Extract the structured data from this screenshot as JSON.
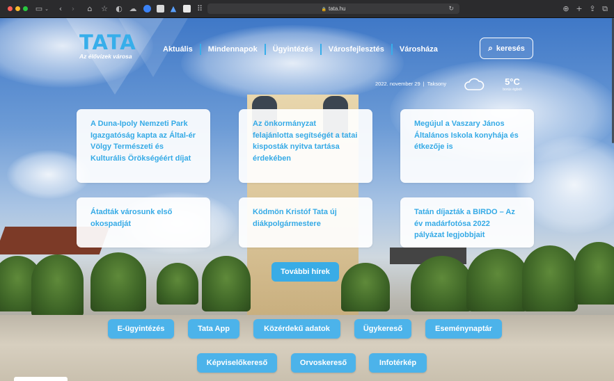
{
  "browser": {
    "url": "tata.hu",
    "icons": [
      "sidebar-icon",
      "back-icon",
      "forward-icon",
      "home-icon",
      "bookmark-star-icon",
      "shield-icon",
      "cloud-icon",
      "download-icon",
      "share-icon",
      "new-tab-icon",
      "tabs-overview-icon"
    ]
  },
  "header": {
    "logo_title": "TATA",
    "logo_subtitle": "Az élővizek városa",
    "nav": [
      "Aktuális",
      "Mindennapok",
      "Ügyintézés",
      "Városfejlesztés",
      "Városháza"
    ],
    "search_label": "keresés"
  },
  "info": {
    "date": "2022. november 29",
    "nameday": "Taksony",
    "temperature": "5°C",
    "weather_desc": "borús égbolt"
  },
  "news": [
    "A Duna-Ipoly Nemzeti Park Igazgatóság kapta az Által-ér Völgy Természeti és Kulturális Örökségéért díjat",
    "Az önkormányzat felajánlotta segítségét a tatai kisposták nyitva tartása érdekében",
    "Megújul a Vaszary János Általános Iskola konyhája és étkezője is",
    "Átadták városunk első okospadját",
    "Ködmön Kristóf Tata új diákpolgármestere",
    "Tatán díjazták a BIRDO – Az év madárfotósa 2022 pályázat legjobbjait"
  ],
  "more_news_label": "További hírek",
  "quick_links": [
    "E-ügyintézés",
    "Tata App",
    "Közérdekű adatok",
    "Ügykereső",
    "Eseménynaptár",
    "Képviselőkereső",
    "Orvoskereső",
    "Infotérkép"
  ],
  "colors": {
    "accent": "#37aeea",
    "button": "#4cb3ea"
  }
}
